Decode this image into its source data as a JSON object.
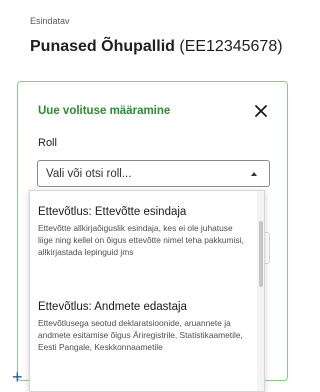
{
  "header": {
    "eyebrow": "Esindatav",
    "entity_name": "Punased Õhupallid",
    "entity_code": "(EE12345678)"
  },
  "dialog": {
    "title": "Uue volituse määramine",
    "close_icon": "close-icon",
    "role_label": "Roll",
    "role_placeholder": "Vali või otsi roll..."
  },
  "dropdown": {
    "options": [
      {
        "title": "Ettevõtlus: Ettevõtte esindaja",
        "description": "Ettevõtte allkirjaõiguslik esindaja, kes ei ole juhatuse liige ning kellel on õigus ettevõtte nimel teha pakkumisi, allkirjastada lepinguid jms"
      },
      {
        "title": "Ettevõtlus: Andmete edastaja",
        "description": "Ettevõtlusega seotud deklaratsioonide, aruannete ja andmete esitamise õigus Äriregistrile, Statistikaametile, Eesti Pangale, Keskkonnaametile"
      }
    ]
  },
  "footer": {
    "add_icon_glyph": "+"
  },
  "colors": {
    "accent_green": "#2e8b2e",
    "panel_border": "#8cc98c",
    "link_blue": "#2a5c9a"
  }
}
